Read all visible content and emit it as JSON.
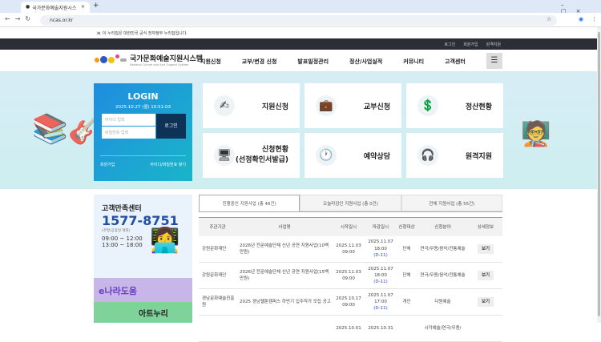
{
  "browser": {
    "tab_title": "국가문화예술지원시스템",
    "url": "ncas.or.kr"
  },
  "gov_banner": "이 누리집은 대한민국 공식 전자정부 누리집입니다.",
  "topbar": [
    "로그인",
    "회원가입",
    "원격지원"
  ],
  "logo": {
    "title": "국가문화예술지원시스템",
    "subtitle": "National Culture and Arts Support System"
  },
  "nav": [
    "지원신청",
    "교부/변경 신청",
    "발표일정관리",
    "정산/사업실적",
    "커뮤니티",
    "고객센터"
  ],
  "login": {
    "title": "LOGIN",
    "datetime": "2025.10.27 (월) 10:51:03",
    "id_placeholder": "아이디 입력",
    "pw_placeholder": "비밀번호 입력",
    "button": "로그인",
    "signup": "회원가입",
    "find": "아이디/비밀번호 찾기"
  },
  "tiles": [
    {
      "label": "지원신청",
      "icon": "✍"
    },
    {
      "label": "교부신청",
      "icon": "💼"
    },
    {
      "label": "정산현황",
      "icon": "💲"
    },
    {
      "label": "신청현황\n(선정확인서발급)",
      "icon": "🖥"
    },
    {
      "label": "예약상담",
      "icon": "🕐"
    },
    {
      "label": "원격지원",
      "icon": "🎧"
    }
  ],
  "cs": {
    "title": "고객만족센터",
    "phone": "1577-8751",
    "note": "(주말/공휴일 제외)",
    "hours1": "09:00 ~ 12:00",
    "hours2": "13:00 ~ 18:00",
    "banner1": "e나라도움",
    "banner2": "아트누리"
  },
  "tabs": [
    "진행중인 지원사업 (총 46건)",
    "오늘마감인 지원사업 (총 0건)",
    "전체 지원사업 (총 55건)"
  ],
  "table": {
    "headers": [
      "주관기관",
      "사업명",
      "시작일시",
      "마감일시",
      "신청대상",
      "신청분야",
      "상세정보"
    ],
    "rows": [
      {
        "org": "강원문화재단",
        "name": "2026년 전문예술단체 신년 공연 지원사업(10백만원)",
        "start": "2025.11.03 09:00",
        "end": "2025.11.07 18:00",
        "dday": "(D-11)",
        "target": "단체",
        "field": "연극/무용/음악/전통예술",
        "view": "보기"
      },
      {
        "org": "강원문화재단",
        "name": "2026년 전문예술단체 신년 공연 지원사업(15백만원)",
        "start": "2025.11.03 09:00",
        "end": "2025.11.07 18:00",
        "dday": "(D-11)",
        "target": "단체",
        "field": "연극/무용/음악/전통예술",
        "view": "보기"
      },
      {
        "org": "경남문화예술진흥원",
        "name": "2025 경남웹툰캠퍼스 하반기 입주작가 모집 공고",
        "start": "2025.10.17 09:00",
        "end": "2025.11.07 17:00",
        "dday": "(D-11)",
        "target": "개인",
        "field": "다원예술",
        "view": "보기"
      },
      {
        "org": "",
        "name": "",
        "start": "2025.10.01",
        "end": "2025.10.31",
        "dday": "",
        "target": "",
        "field": "시각예술/연극/무용/",
        "view": ""
      }
    ]
  }
}
